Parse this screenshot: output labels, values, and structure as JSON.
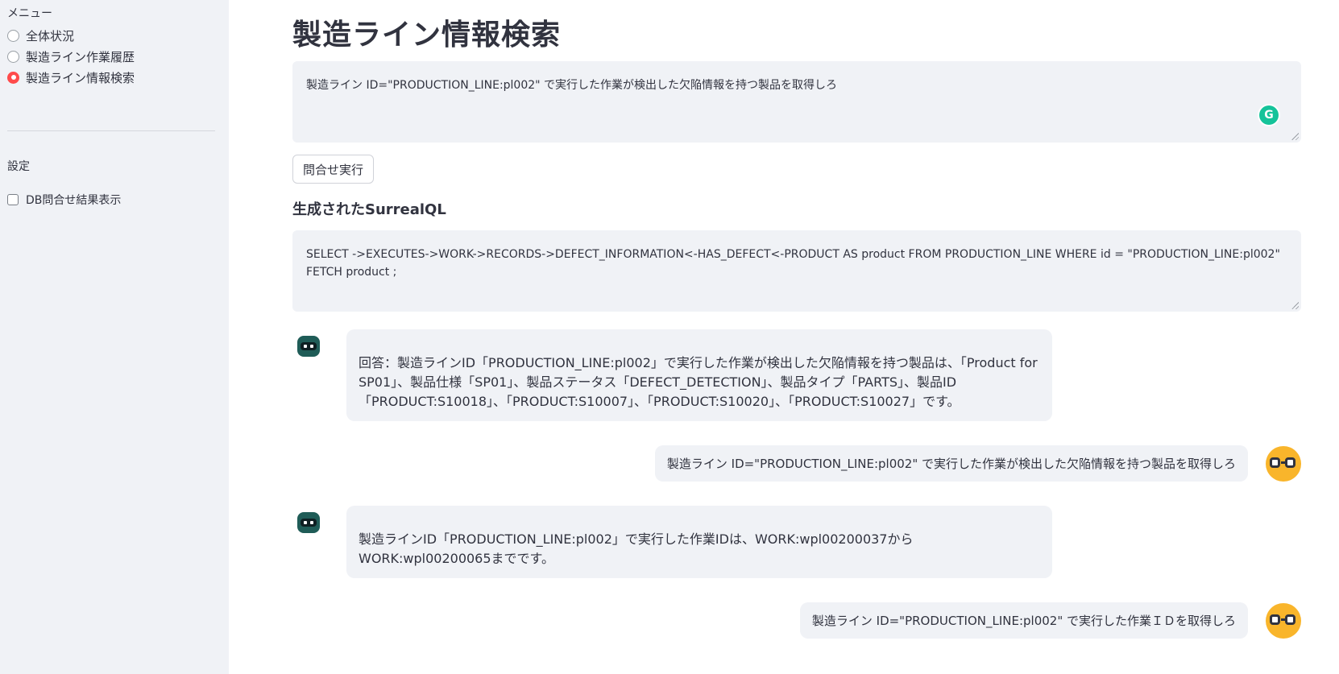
{
  "sidebar": {
    "menu_label": "メニュー",
    "menu_items": [
      {
        "label": "全体状況",
        "selected": false
      },
      {
        "label": "製造ライン作業履歴",
        "selected": false
      },
      {
        "label": "製造ライン情報検索",
        "selected": true
      }
    ],
    "settings_label": "設定",
    "checkbox_label": "DB問合せ結果表示",
    "checkbox_checked": false
  },
  "main": {
    "title": "製造ライン情報検索",
    "prompt_value": "製造ライン ID=\"PRODUCTION_LINE:pl002\" で実行した作業が検出した欠陥情報を持つ製品を取得しろ",
    "run_button_label": "問合せ実行",
    "generated_heading": "生成されたSurrealQL",
    "generated_sql": "SELECT ->EXECUTES->WORK->RECORDS->DEFECT_INFORMATION<-HAS_DEFECT<-PRODUCT AS product FROM PRODUCTION_LINE WHERE id = \"PRODUCTION_LINE:pl002\" FETCH product ;"
  },
  "chat": {
    "messages": [
      {
        "role": "assistant",
        "text": "回答：製造ラインID「PRODUCTION_LINE:pl002」で実行した作業が検出した欠陥情報を持つ製品は、「Product for SP01」、製品仕様「SP01」、製品ステータス「DEFECT_DETECTION」、製品タイプ「PARTS」、製品ID「PRODUCT:S10018」、「PRODUCT:S10007」、「PRODUCT:S10020」、「PRODUCT:S10027」です。"
      },
      {
        "role": "user",
        "text": "製造ライン ID=\"PRODUCTION_LINE:pl002\" で実行した作業が検出した欠陥情報を持つ製品を取得しろ"
      },
      {
        "role": "assistant",
        "text": "製造ラインID「PRODUCTION_LINE:pl002」で実行した作業IDは、WORK:wpl00200037からWORK:wpl00200065までです。"
      },
      {
        "role": "user",
        "text": "製造ライン ID=\"PRODUCTION_LINE:pl002\" で実行した作業ＩＤを取得しろ"
      }
    ]
  },
  "colors": {
    "sidebar_bg": "#f0f2f6",
    "accent": "#ff4b4b",
    "bubble_bg": "#f0f2f6",
    "user_avatar": "#f9b52b",
    "bot_avatar": "#1f5c57",
    "grammarly": "#15c39a"
  },
  "icons": {
    "grammarly": "G",
    "bot_avatar": "robot-avatar-icon",
    "user_avatar": "nerd-face-avatar-icon"
  }
}
